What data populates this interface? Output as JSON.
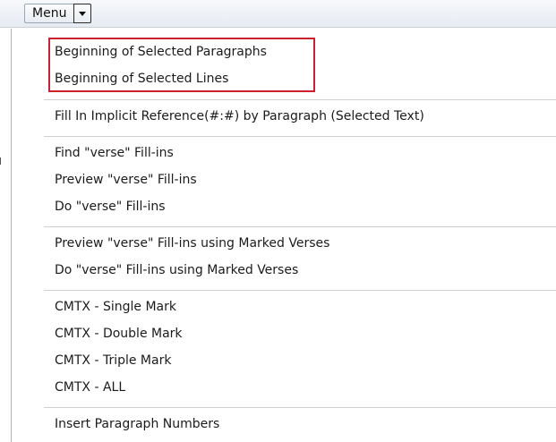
{
  "toolbar": {
    "menu_label": "Menu",
    "dropdown_icon": "chevron-down-icon"
  },
  "menu": {
    "groups": [
      {
        "items": [
          "Beginning of Selected Paragraphs",
          "Beginning of Selected Lines"
        ],
        "highlighted": true,
        "highlight_color": "#c8232c"
      },
      {
        "items": [
          "Fill In Implicit Reference(#:#) by Paragraph (Selected Text)"
        ]
      },
      {
        "items": [
          "Find \"verse\" Fill-ins",
          "Preview \"verse\" Fill-ins",
          "Do \"verse\" Fill-ins"
        ]
      },
      {
        "items": [
          "Preview \"verse\" Fill-ins using Marked Verses",
          "Do \"verse\" Fill-ins using Marked Verses"
        ]
      },
      {
        "items": [
          "CMTX - Single Mark",
          "CMTX - Double Mark",
          "CMTX - Triple Mark",
          "CMTX - ALL"
        ]
      },
      {
        "items": [
          "Insert Paragraph Numbers"
        ]
      }
    ]
  }
}
